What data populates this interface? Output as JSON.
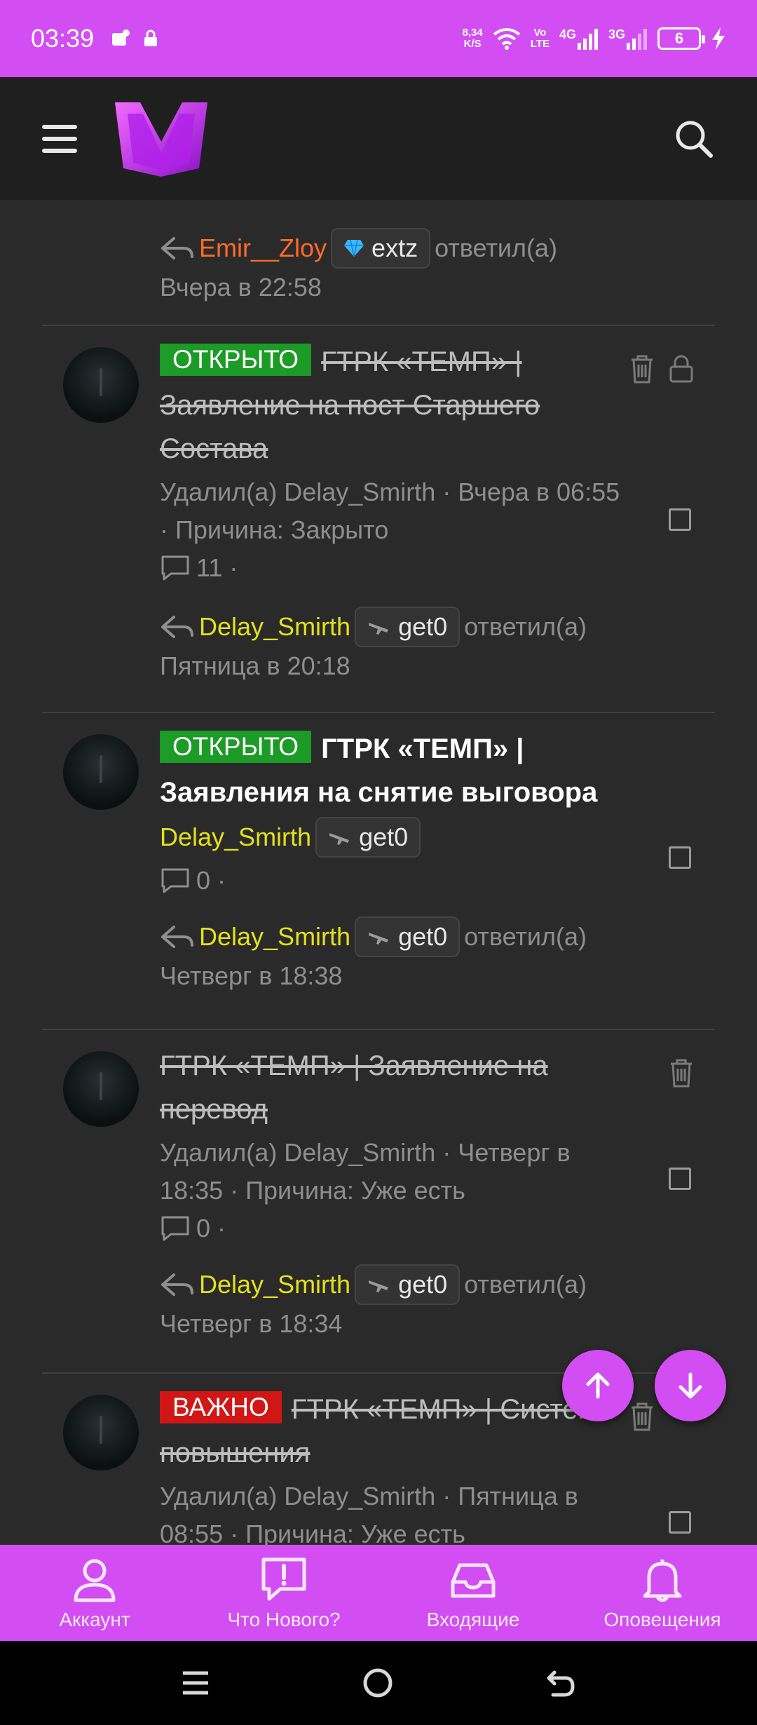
{
  "status_bar": {
    "time": "03:39",
    "net_speed_top": "8,34",
    "net_speed_bottom": "K/S",
    "volte_top": "Vo",
    "volte_bottom": "LTE",
    "sig1": "4G",
    "sig2": "3G",
    "battery": "6"
  },
  "header": {
    "menu_icon": "hamburger-icon",
    "logo": "M",
    "search_icon": "search-icon"
  },
  "partial_item": {
    "user": "Emir__Zloy",
    "pill_user": "extz",
    "action": "ответил(а)",
    "time": "Вчера в 22:58"
  },
  "threads": [
    {
      "badge": "ОТКРЫТО",
      "title": "ГТРК «ТЕМП» | Заявление на пост Старшего Состава",
      "deleted": true,
      "meta_line1": "Удалил(а) Delay_Smirth · Вчера в 06:55",
      "meta_line2": "· Причина: Закрыто",
      "replies": "11 ·",
      "last_user": "Delay_Smirth",
      "last_pill": "get0",
      "last_action": "ответил(а)",
      "last_time": "Пятница в 20:18"
    },
    {
      "badge": "ОТКРЫТО",
      "title_line1": "ГТРК «ТЕМП» |",
      "title_line2": "Заявления на снятие выговора",
      "deleted": false,
      "author": "Delay_Smirth",
      "author_pill": "get0",
      "replies": "0 ·",
      "last_user": "Delay_Smirth",
      "last_pill": "get0",
      "last_action": "ответил(а)",
      "last_time": "Четверг в 18:38"
    },
    {
      "title": "ГТРК «ТЕМП» | Заявление на перевод",
      "deleted": true,
      "meta_line1": "Удалил(а) Delay_Smirth · Четверг в",
      "meta_line2": "18:35 · Причина: Уже есть",
      "replies": "0 ·",
      "last_user": "Delay_Smirth",
      "last_pill": "get0",
      "last_action": "ответил(а)",
      "last_time": "Четверг в 18:34"
    },
    {
      "badge": "ВАЖНО",
      "title": "ГТРК «ТЕМП» | Система повышения",
      "deleted": true,
      "meta_line1": "Удалил(а) Delay_Smirth · Пятница в",
      "meta_line2": "08:55 · Причина: Уже есть"
    }
  ],
  "bottom_nav": [
    {
      "label": "Аккаунт",
      "icon": "account-icon"
    },
    {
      "label": "Что Нового?",
      "icon": "whats-new-icon"
    },
    {
      "label": "Входящие",
      "icon": "inbox-icon"
    },
    {
      "label": "Оповещения",
      "icon": "bell-icon"
    }
  ],
  "colors": {
    "accent": "#d24ef2",
    "open": "#1c9b27",
    "important": "#d11616",
    "username_yellow": "#e3e01e",
    "username_orange": "#ff6b2a"
  }
}
